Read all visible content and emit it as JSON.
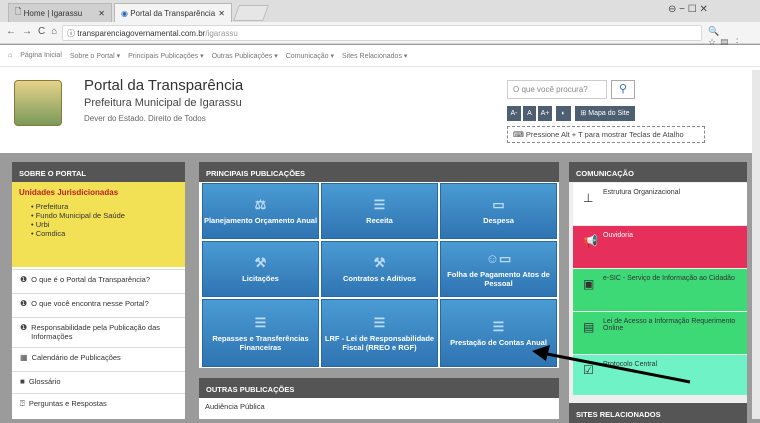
{
  "browser": {
    "tab1_title": "Home | Igarassu",
    "tab2_title": "Portal da Transparência",
    "url_host": "transparenciagovernamental.com.br",
    "url_path": "/igarassu",
    "win_controls": "⊖   −   ☐   ✕"
  },
  "sitenav": {
    "items": [
      "Página Inicial",
      "Sobre o Portal ▾",
      "Principais Publicações ▾",
      "Outras Publicações ▾",
      "Comunicação ▾",
      "Sites Relacionados ▾"
    ]
  },
  "header": {
    "title": "Portal da Transparência",
    "subtitle": "Prefeitura Municipal de Igarassu",
    "motto": "Dever do Estado. Direito de Todos",
    "search_placeholder": "O que você procura?",
    "font_small": "A-",
    "font_normal": "A",
    "font_big": "A+",
    "contrast": "◐",
    "sitemap": "Mapa do Site",
    "hint": "Pressione Alt + T para mostrar Teclas de Atalho"
  },
  "left": {
    "header": "SOBRE O PORTAL",
    "unidades_title": "Unidades Jurisdicionadas",
    "unidades": [
      "Prefeitura",
      "Fundo Municipal de Saúde",
      "Urbi",
      "Comdica"
    ],
    "items": [
      "O que é o Portal da Transparência?",
      "O que você encontra nesse Portal?",
      "Responsabilidade pela Publicação das Informações",
      "Calendário de Publicações",
      "Glossário",
      "Perguntas e Respostas"
    ]
  },
  "center": {
    "header": "PRINCIPAIS PUBLICAÇÕES",
    "tiles": [
      "Planejamento Orçamento Anual",
      "Receita",
      "Despesa",
      "Licitações",
      "Contratos e Aditivos",
      "Folha de Pagamento Atos de Pessoal",
      "Repasses e Transferências Financeiras",
      "LRF - Lei de Responsabilidade Fiscal (RREO e RGF)",
      "Prestação de Contas Anual"
    ],
    "outros_header": "OUTRAS PUBLICAÇÕES",
    "outros_first": "Audiência Pública"
  },
  "right": {
    "header": "COMUNICAÇÃO",
    "items": [
      "Estrutura Organizacional",
      "Ouvidoria",
      "e-SIC - Serviço de Informação ao Cidadão",
      "Lei de Acesso a Informação Requerimento Online",
      "Protocolo Central"
    ],
    "sites_header": "SITES RELACIONADOS"
  }
}
